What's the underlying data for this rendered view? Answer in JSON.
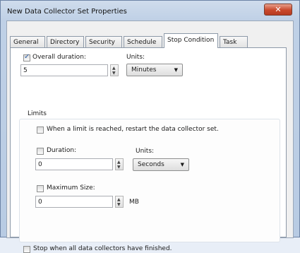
{
  "window": {
    "title": "New Data Collector Set Properties",
    "close_glyph": "✕"
  },
  "tabs": [
    {
      "label": "General"
    },
    {
      "label": "Directory"
    },
    {
      "label": "Security"
    },
    {
      "label": "Schedule"
    },
    {
      "label": "Stop Condition",
      "active": true
    },
    {
      "label": "Task"
    }
  ],
  "overall": {
    "checkbox_label": "Overall duration:",
    "checked": true,
    "value": "5",
    "units_label": "Units:",
    "units_value": "Minutes"
  },
  "limits": {
    "title": "Limits",
    "restart_label": "When a limit is reached, restart the data collector set.",
    "duration_label": "Duration:",
    "duration_value": "0",
    "duration_units_label": "Units:",
    "duration_units_value": "Seconds",
    "max_size_label": "Maximum Size:",
    "max_size_value": "0",
    "max_size_unit": "MB"
  },
  "stop_all": {
    "label": "Stop when all data collectors have finished."
  }
}
